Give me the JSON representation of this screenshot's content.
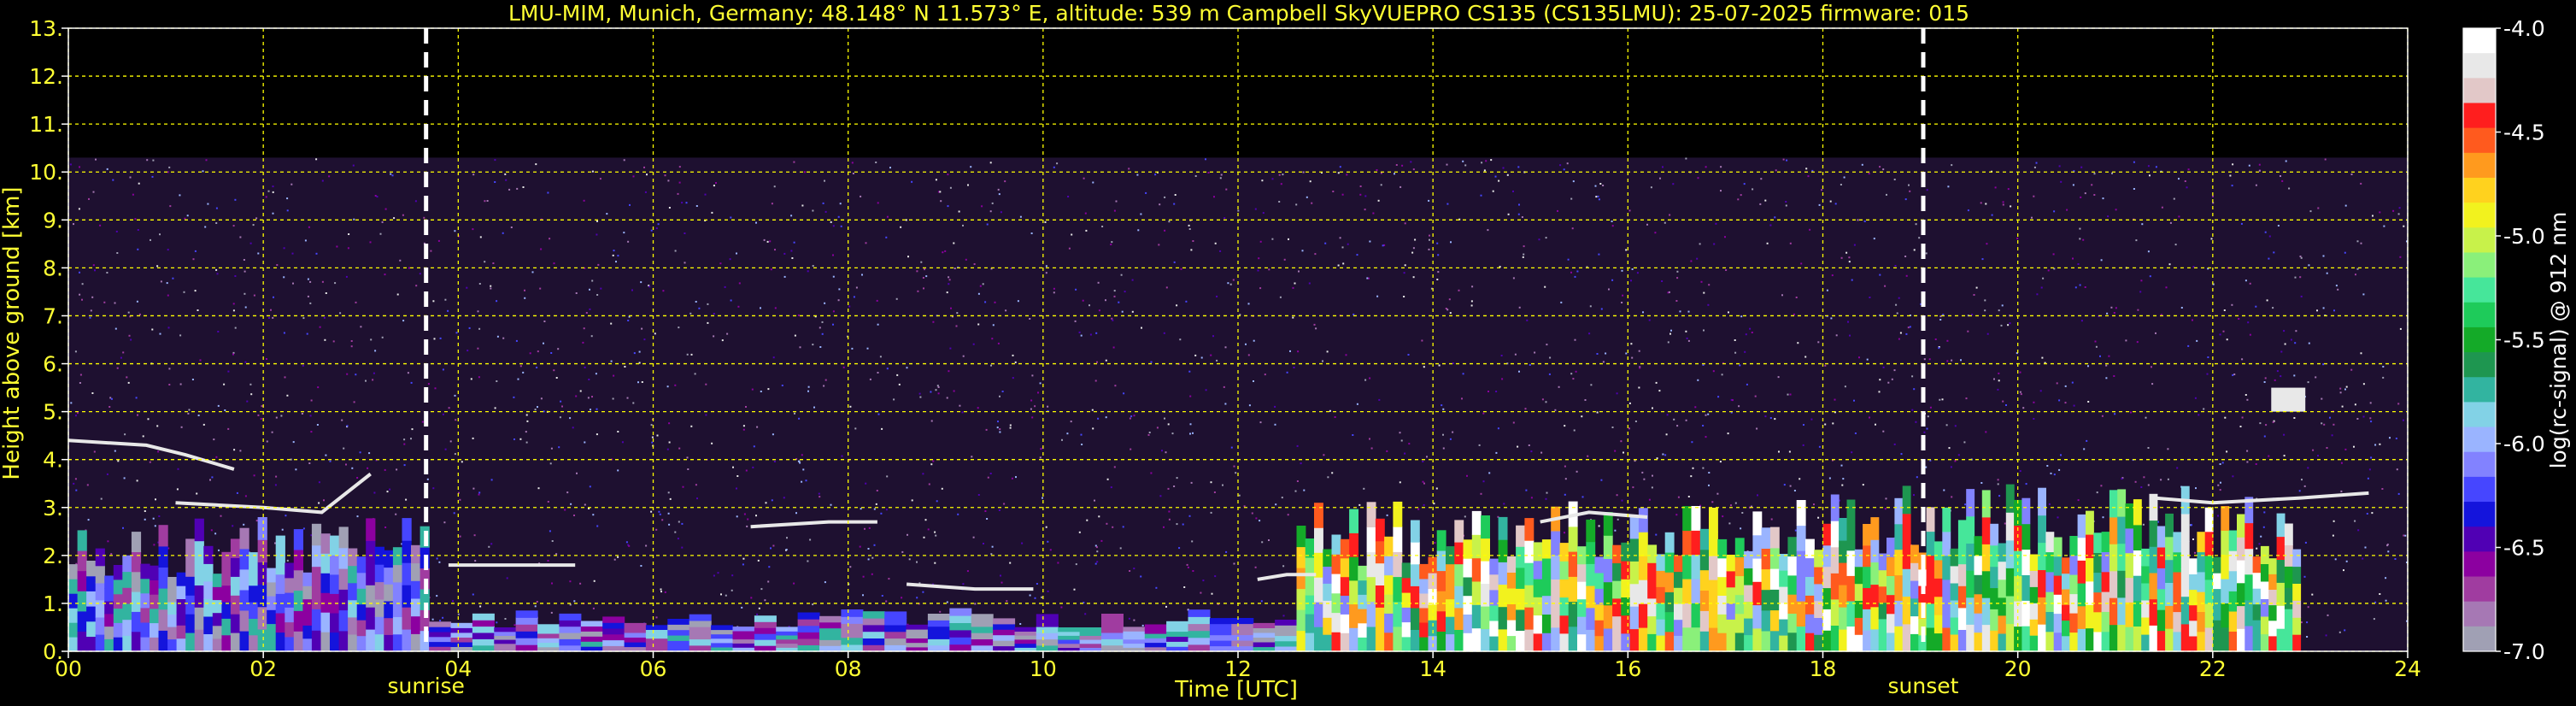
{
  "chart_data": {
    "type": "heatmap",
    "title": "LMU-MIM, Munich, Germany; 48.148° N 11.573° E, altitude: 539 m    Campbell SkyVUEPRO CS135 (CS135LMU): 25-07-2025    firmware: 015",
    "xlabel": "Time [UTC]",
    "ylabel": "Height above ground [km]",
    "xlim": [
      0,
      24
    ],
    "ylim": [
      0,
      13
    ],
    "x_ticks": [
      "00",
      "02",
      "04",
      "06",
      "08",
      "10",
      "12",
      "14",
      "16",
      "18",
      "20",
      "22",
      "24"
    ],
    "y_ticks": [
      "0.",
      "1.",
      "2.",
      "3.",
      "4.",
      "5.",
      "6.",
      "7.",
      "8.",
      "9.",
      "10.",
      "11.",
      "12.",
      "13."
    ],
    "grid": true,
    "grid_color": "#ffff00",
    "background_color": "#000000",
    "annotations": [
      {
        "label": "sunrise",
        "time": 3.67
      },
      {
        "label": "sunset",
        "time": 19.03
      }
    ],
    "colorbar": {
      "label": "log(rc-signal) @ 912 nm",
      "range": [
        -7.0,
        -4.0
      ],
      "ticks": [
        "-4.0",
        "-4.5",
        "-5.0",
        "-5.5",
        "-6.0",
        "-6.5",
        "-7.0"
      ],
      "colors": [
        "#ffffff",
        "#e8e8e8",
        "#e2c8c8",
        "#ff1e1e",
        "#ff5a1e",
        "#ff9a1e",
        "#ffd21e",
        "#f2f21e",
        "#c8f24a",
        "#8af07a",
        "#46e69a",
        "#1ecb5a",
        "#14aa28",
        "#1e9650",
        "#32b4a0",
        "#82d2e6",
        "#9ab4ff",
        "#8282ff",
        "#4646ff",
        "#1414dc",
        "#5000b4",
        "#8c00a0",
        "#a03ca0",
        "#a678b4",
        "#a0a0b4"
      ]
    },
    "features": [
      {
        "kind": "noise",
        "t0": 0.0,
        "t1": 24.0,
        "h0": 0.0,
        "h1": 10.3
      },
      {
        "kind": "boundary_layer",
        "t0": 0.0,
        "t1": 3.7,
        "h0": 0.0,
        "h1": 2.8
      },
      {
        "kind": "boundary_layer",
        "t0": 3.7,
        "t1": 12.6,
        "h0": 0.0,
        "h1": 0.9
      },
      {
        "kind": "convective",
        "t0": 12.6,
        "t1": 18.0,
        "h0": 0.0,
        "h1": 3.2
      },
      {
        "kind": "convective",
        "t0": 18.0,
        "t1": 22.9,
        "h0": 0.0,
        "h1": 3.5
      },
      {
        "kind": "cloud_layer",
        "points": [
          [
            0.0,
            4.4
          ],
          [
            0.8,
            4.3
          ],
          [
            1.2,
            4.1
          ],
          [
            1.7,
            3.8
          ]
        ]
      },
      {
        "kind": "cloud_layer",
        "points": [
          [
            1.1,
            3.1
          ],
          [
            2.0,
            3.0
          ],
          [
            2.6,
            2.9
          ],
          [
            3.1,
            3.7
          ]
        ]
      },
      {
        "kind": "cloud_layer",
        "points": [
          [
            3.9,
            1.8
          ],
          [
            4.6,
            1.8
          ],
          [
            5.2,
            1.8
          ]
        ]
      },
      {
        "kind": "cloud_layer",
        "points": [
          [
            7.0,
            2.6
          ],
          [
            7.8,
            2.7
          ],
          [
            8.3,
            2.7
          ]
        ]
      },
      {
        "kind": "cloud_layer",
        "points": [
          [
            8.6,
            1.4
          ],
          [
            9.3,
            1.3
          ],
          [
            9.9,
            1.3
          ]
        ]
      },
      {
        "kind": "cloud_layer",
        "points": [
          [
            12.2,
            1.5
          ],
          [
            12.5,
            1.6
          ],
          [
            12.8,
            1.6
          ]
        ]
      },
      {
        "kind": "cloud_layer",
        "points": [
          [
            15.1,
            2.7
          ],
          [
            15.6,
            2.9
          ],
          [
            16.2,
            2.8
          ]
        ]
      },
      {
        "kind": "cloud_layer",
        "points": [
          [
            21.4,
            3.2
          ],
          [
            22.0,
            3.1
          ],
          [
            22.9,
            3.2
          ],
          [
            23.6,
            3.3
          ]
        ]
      },
      {
        "kind": "cloud_patch",
        "t0": 22.6,
        "t1": 22.95,
        "h0": 5.0,
        "h1": 5.5
      }
    ]
  }
}
